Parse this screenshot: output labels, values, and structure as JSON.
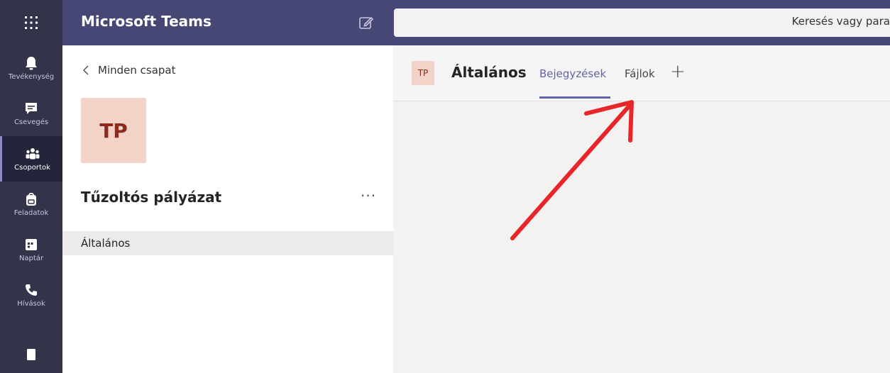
{
  "app": {
    "title": "Microsoft Teams"
  },
  "search": {
    "placeholder": "Keresés vagy para"
  },
  "rail": {
    "items": [
      {
        "label": "Tevékenység",
        "icon": "bell-icon",
        "active": false
      },
      {
        "label": "Csevegés",
        "icon": "chat-icon",
        "active": false
      },
      {
        "label": "Csoportok",
        "icon": "teams-icon",
        "active": true
      },
      {
        "label": "Feladatok",
        "icon": "backpack-icon",
        "active": false
      },
      {
        "label": "Naptár",
        "icon": "calendar-icon",
        "active": false
      },
      {
        "label": "Hívások",
        "icon": "phone-icon",
        "active": false
      }
    ]
  },
  "team_panel": {
    "back_label": "Minden csapat",
    "avatar_initials": "TP",
    "team_name": "Tűzoltós pályázat",
    "more_label": "···",
    "channels": [
      {
        "name": "Általános",
        "selected": true
      }
    ]
  },
  "channel": {
    "avatar_initials": "TP",
    "title": "Általános",
    "tabs": [
      {
        "label": "Bejegyzések",
        "active": true
      },
      {
        "label": "Fájlok",
        "active": false
      }
    ],
    "add_tab_label": "+"
  },
  "colors": {
    "accent": "#6264a7",
    "topbar": "#464775",
    "rail": "#33344a",
    "annotation_arrow": "#e8262a"
  }
}
